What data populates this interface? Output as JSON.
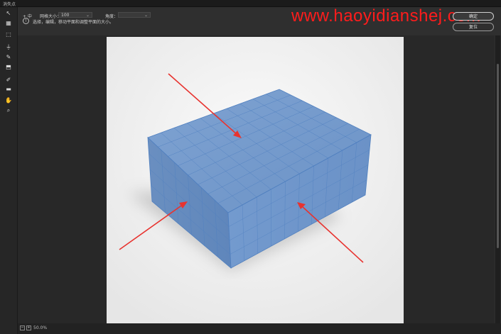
{
  "window": {
    "title": "消失点"
  },
  "options": {
    "edit_label": "+ 中",
    "grid_size_label": "网格大小：",
    "grid_size_value": "100",
    "angle_label": "角度：",
    "angle_value": ""
  },
  "instruction": "选择，编辑，移动平面和调整平面的大小。",
  "watermark": "www.haoyidianshej.com",
  "buttons": {
    "ok_label": "确定",
    "reset_label": "复位"
  },
  "tools": [
    {
      "name": "edit-plane-tool",
      "icon": "arrow-cursor-icon",
      "glyph": "↖"
    },
    {
      "name": "create-plane-tool",
      "icon": "grid-plane-icon",
      "glyph": "▦"
    },
    {
      "name": "marquee-tool",
      "icon": "marquee-icon",
      "glyph": "⬚"
    },
    {
      "name": "stamp-tool",
      "icon": "stamp-icon",
      "glyph": "⏚"
    },
    {
      "name": "brush-tool",
      "icon": "brush-icon",
      "glyph": "✎"
    },
    {
      "name": "transform-tool",
      "icon": "transform-icon",
      "glyph": "⬒"
    },
    {
      "name": "eyedropper-tool",
      "icon": "eyedropper-icon",
      "glyph": "✐"
    },
    {
      "name": "measure-tool",
      "icon": "ruler-icon",
      "glyph": "▬"
    },
    {
      "name": "hand-tool",
      "icon": "hand-icon",
      "glyph": "✋"
    },
    {
      "name": "zoom-tool",
      "icon": "zoom-icon",
      "glyph": "⌕"
    }
  ],
  "status": {
    "zoom_value": "50.0%"
  },
  "colors": {
    "accent_arrow": "#e8332f",
    "box_blue": "#6d93c4",
    "grid_line": "#4e7fc0"
  }
}
